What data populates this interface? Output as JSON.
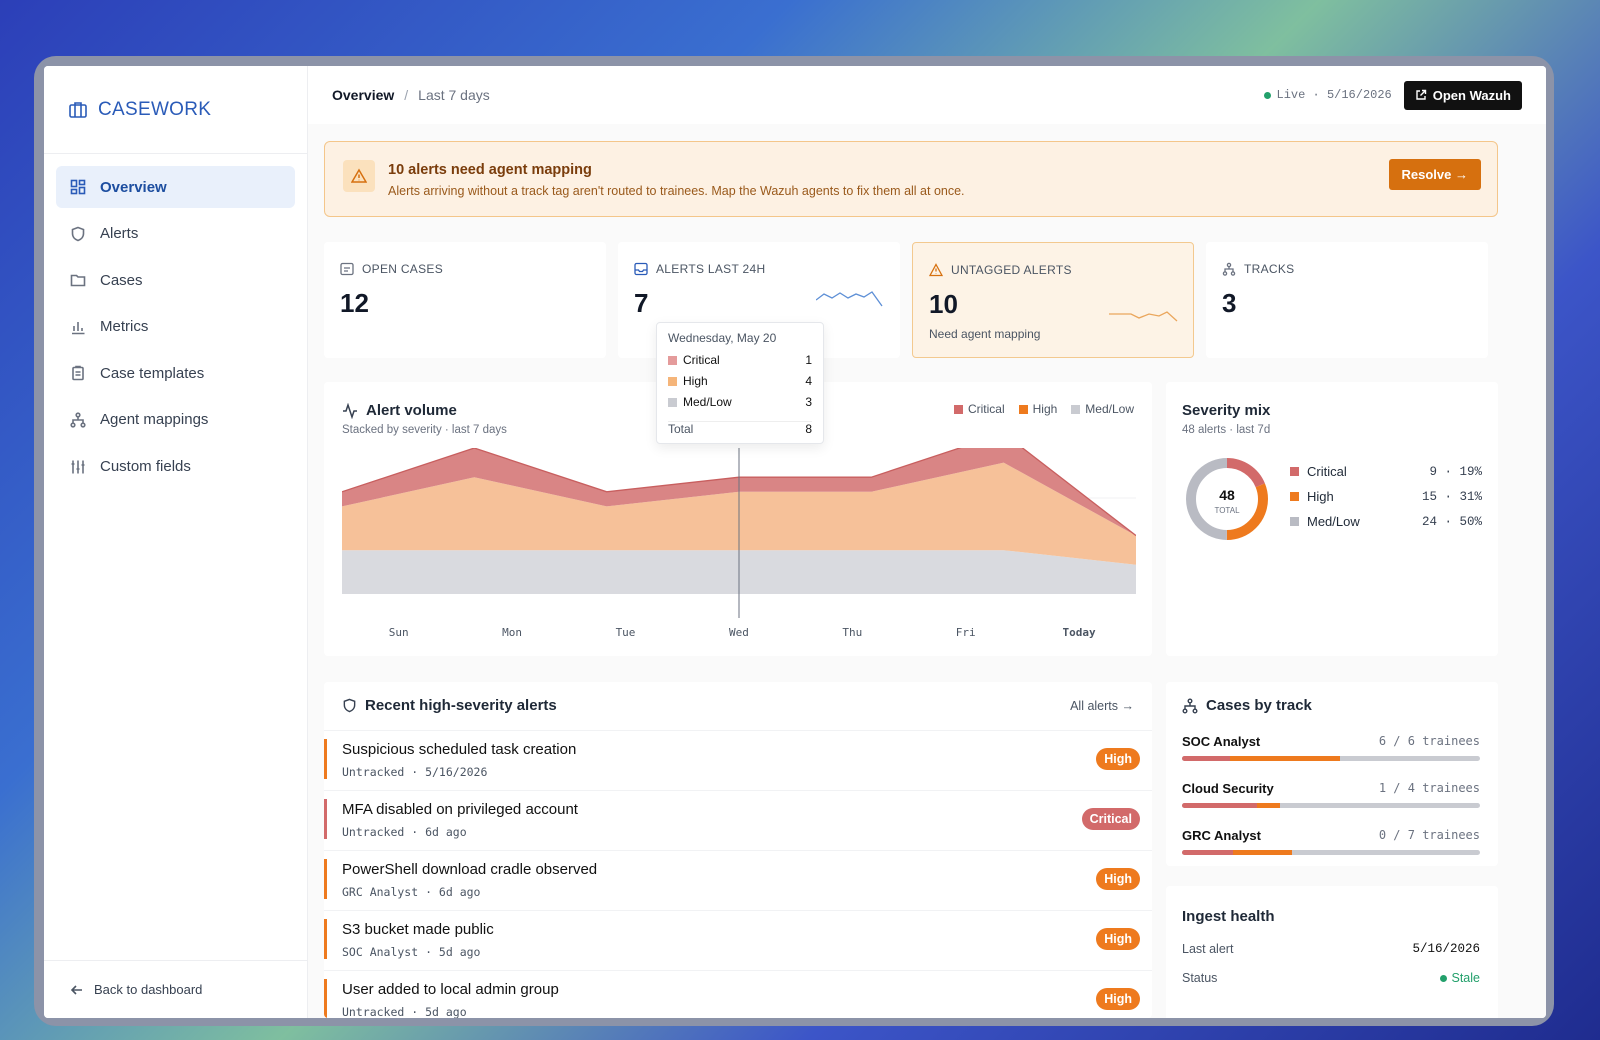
{
  "app": {
    "brand": "CASEWORK"
  },
  "sidebar": {
    "items": [
      {
        "label": "Overview",
        "icon": "dashboard-icon",
        "active": true
      },
      {
        "label": "Alerts",
        "icon": "shield-icon"
      },
      {
        "label": "Cases",
        "icon": "folder-icon"
      },
      {
        "label": "Metrics",
        "icon": "bar-chart-icon"
      },
      {
        "label": "Case templates",
        "icon": "clipboard-icon"
      },
      {
        "label": "Agent mappings",
        "icon": "network-icon"
      },
      {
        "label": "Custom fields",
        "icon": "sliders-icon"
      }
    ],
    "back_label": "Back to dashboard"
  },
  "header": {
    "crumb": "Overview",
    "crumb_sep": "/",
    "range": "Last 7 days",
    "live": "Live · 5/16/2026",
    "open_wazuh": "Open Wazuh"
  },
  "banner": {
    "title": "10 alerts need agent mapping",
    "text": "Alerts arriving without a track tag aren't routed to trainees. Map the Wazuh agents to fix them all at once.",
    "button": "Resolve"
  },
  "kpis": [
    {
      "label": "OPEN CASES",
      "value": "12",
      "sub": ""
    },
    {
      "label": "ALERTS LAST 24H",
      "value": "7",
      "sub": ""
    },
    {
      "label": "UNTAGGED ALERTS",
      "value": "10",
      "sub": "Need agent mapping"
    },
    {
      "label": "TRACKS",
      "value": "3",
      "sub": ""
    }
  ],
  "alert_volume": {
    "title": "Alert volume",
    "subtitle": "Stacked by severity · last 7 days",
    "legend": [
      "Critical",
      "High",
      "Med/Low"
    ]
  },
  "tooltip": {
    "date": "Wednesday, May 20",
    "rows": [
      {
        "label": "Critical",
        "value": "1"
      },
      {
        "label": "High",
        "value": "4"
      },
      {
        "label": "Med/Low",
        "value": "3"
      }
    ],
    "total_label": "Total",
    "total": "8"
  },
  "chart_data": {
    "type": "area",
    "categories": [
      "Sun",
      "Mon",
      "Tue",
      "Wed",
      "Thu",
      "Fri",
      "Today"
    ],
    "series": [
      {
        "name": "Med/Low",
        "values": [
          3,
          3,
          3,
          3,
          3,
          3,
          2
        ]
      },
      {
        "name": "High",
        "values": [
          3,
          5,
          3,
          4,
          4,
          6,
          2
        ]
      },
      {
        "name": "Critical",
        "values": [
          1,
          2,
          1,
          1,
          1,
          2,
          0
        ]
      }
    ],
    "colors": {
      "Critical": "#d98585",
      "High": "#f6c199",
      "Med/Low": "#d9dadf"
    },
    "ylim": [
      0,
      10
    ],
    "highlight_index": 3
  },
  "severity_mix": {
    "title": "Severity mix",
    "subtitle": "48 alerts · last 7d",
    "total": "48",
    "total_label": "TOTAL",
    "rows": [
      {
        "label": "Critical",
        "count": "9",
        "pct": "19%",
        "color": "#d26a6a"
      },
      {
        "label": "High",
        "count": "15",
        "pct": "31%",
        "color": "#ee7a1e"
      },
      {
        "label": "Med/Low",
        "count": "24",
        "pct": "50%",
        "color": "#b9bbc3"
      }
    ]
  },
  "recent": {
    "title": "Recent high-severity alerts",
    "all_link": "All alerts",
    "rows": [
      {
        "title": "Suspicious scheduled task creation",
        "meta": "Untracked · 5/16/2026",
        "severity": "High"
      },
      {
        "title": "MFA disabled on privileged account",
        "meta": "Untracked · 6d ago",
        "severity": "Critical"
      },
      {
        "title": "PowerShell download cradle observed",
        "meta": "GRC Analyst · 6d ago",
        "severity": "High"
      },
      {
        "title": "S3 bucket made public",
        "meta": "SOC Analyst · 5d ago",
        "severity": "High"
      },
      {
        "title": "User added to local admin group",
        "meta": "Untracked · 5d ago",
        "severity": "High"
      }
    ]
  },
  "tracks": {
    "title": "Cases by track",
    "rows": [
      {
        "name": "SOC Analyst",
        "count": "6 / 6 trainees",
        "critical": 0.16,
        "high": 0.37
      },
      {
        "name": "Cloud Security",
        "count": "1 / 4 trainees",
        "critical": 0.25,
        "high": 0.08
      },
      {
        "name": "GRC Analyst",
        "count": "0 / 7 trainees",
        "critical": 0.17,
        "high": 0.2
      }
    ]
  },
  "ingest": {
    "title": "Ingest health",
    "last_label": "Last alert",
    "last_value": "5/16/2026",
    "status_label": "Status",
    "status_value": "Stale"
  }
}
